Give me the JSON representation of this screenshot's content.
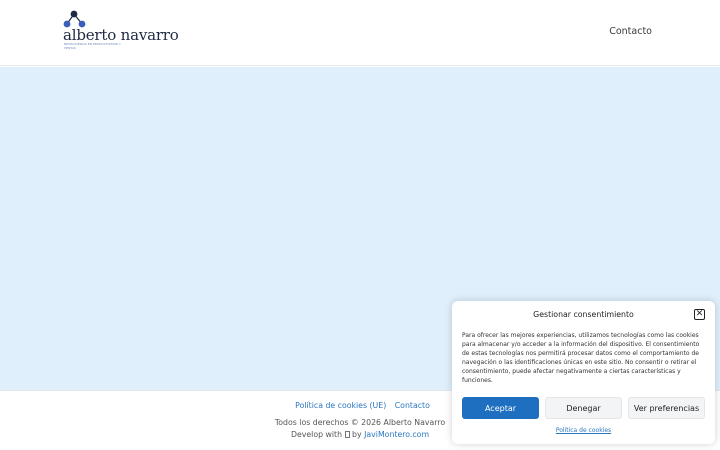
{
  "header": {
    "logo_name": "alberto navarro",
    "logo_tagline": "Neurociencia en productividad y ventas",
    "nav_contact": "Contacto"
  },
  "footer": {
    "link_cookies": "Política de cookies (UE)",
    "link_contact": "Contacto",
    "rights": "Todos los derechos © 2026 Alberto Navarro",
    "develop_prefix": "Develop with",
    "develop_by": "by",
    "develop_link": "JaviMontero.com"
  },
  "cookie_banner": {
    "title": "Gestionar consentimiento",
    "body": "Para ofrecer las mejores experiencias, utilizamos tecnologías como las cookies para almacenar y/o acceder a la información del dispositivo. El consentimiento de estas tecnologías nos permitirá procesar datos como el comportamiento de navegación o las identificaciones únicas en este sitio. No consentir o retirar el consentimiento, puede afectar negativamente a ciertas características y funciones.",
    "accept_label": "Aceptar",
    "deny_label": "Denegar",
    "prefs_label": "Ver preferencias",
    "policy_link": "Política de cookies"
  },
  "colors": {
    "accent": "#1e6fc0",
    "hero_bg": "#e0effc",
    "link": "#2a76c0"
  }
}
